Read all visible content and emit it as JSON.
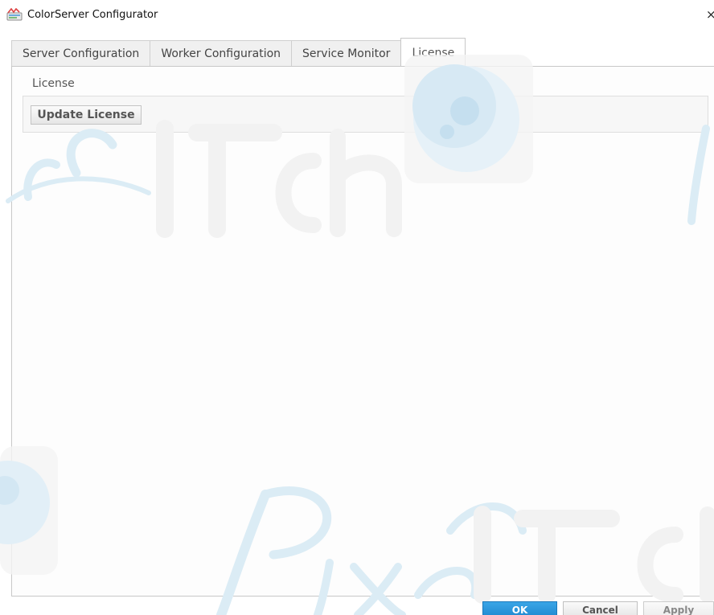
{
  "window": {
    "title": "ColorServer Configurator",
    "close_glyph": "×"
  },
  "tabs": [
    {
      "label": "Server Configuration",
      "active": false
    },
    {
      "label": "Worker Configuration",
      "active": false
    },
    {
      "label": "Service Monitor",
      "active": false
    },
    {
      "label": "License",
      "active": true
    }
  ],
  "license_panel": {
    "section_label": "License",
    "update_button_label": "Update License"
  },
  "footer": {
    "ok_label": "OK",
    "cancel_label": "Cancel",
    "apply_label": "Apply"
  },
  "colors": {
    "accent": "#1f87cf",
    "watermark": "#cfe6f2"
  },
  "icons": {
    "app": "colorserver-app-icon",
    "close": "close-icon"
  }
}
